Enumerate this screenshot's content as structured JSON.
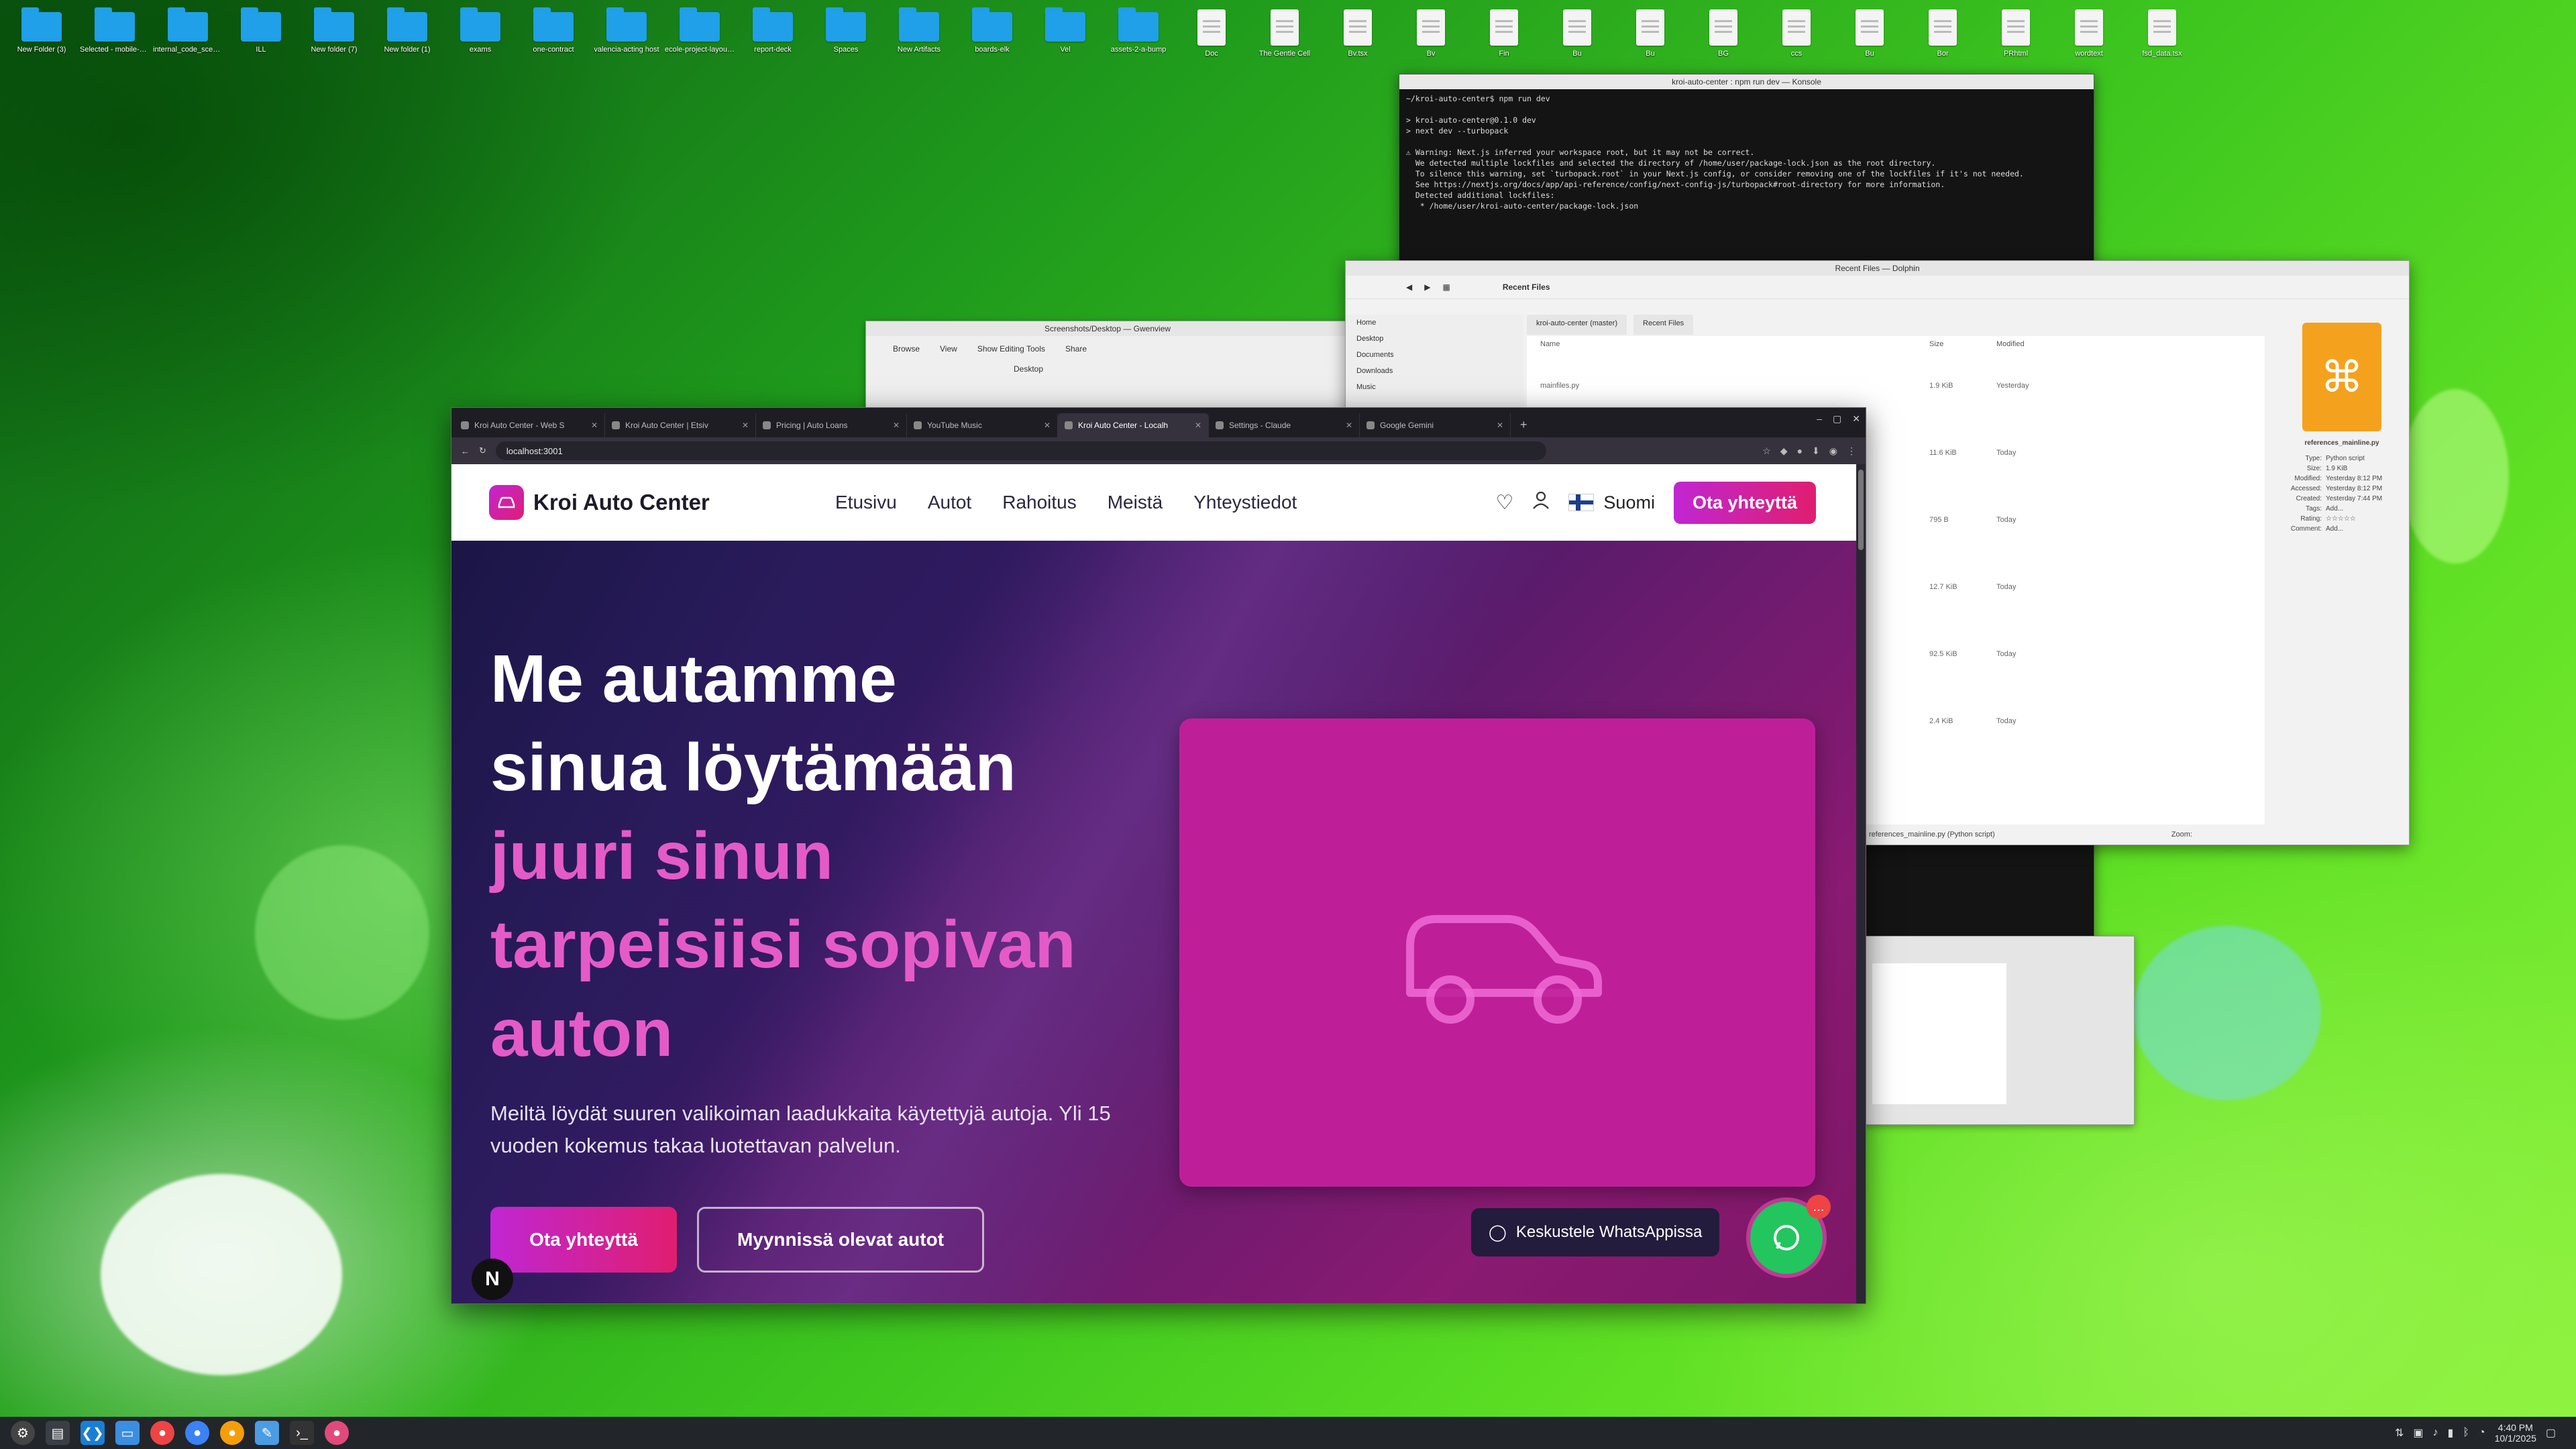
{
  "desktop": {
    "icons": [
      {
        "label": "New Folder (3)",
        "type": "folder"
      },
      {
        "label": "Selected - mobile-code",
        "type": "folder"
      },
      {
        "label": "internal_code_scenario",
        "type": "folder"
      },
      {
        "label": "ILL",
        "type": "folder"
      },
      {
        "label": "New folder (7)",
        "type": "folder"
      },
      {
        "label": "New folder (1)",
        "type": "folder"
      },
      {
        "label": "exams",
        "type": "folder"
      },
      {
        "label": "one-contract",
        "type": "folder"
      },
      {
        "label": "valencia-acting host",
        "type": "folder"
      },
      {
        "label": "ecole-project-layout-file",
        "type": "folder"
      },
      {
        "label": "report-deck",
        "type": "folder"
      },
      {
        "label": "Spaces",
        "type": "folder"
      },
      {
        "label": "New Artifacts",
        "type": "folder"
      },
      {
        "label": "boards-elk",
        "type": "folder"
      },
      {
        "label": "Vel",
        "type": "folder"
      },
      {
        "label": "assets-2-a-bump",
        "type": "folder"
      },
      {
        "label": "Doc",
        "type": "file"
      },
      {
        "label": "The Gentle Cell",
        "type": "file"
      },
      {
        "label": "Bv.tsx",
        "type": "file"
      },
      {
        "label": "Bv",
        "type": "file"
      },
      {
        "label": "Fin",
        "type": "file"
      },
      {
        "label": "Bu",
        "type": "file"
      },
      {
        "label": "Bu",
        "type": "file"
      },
      {
        "label": "BG",
        "type": "file"
      },
      {
        "label": "ccs",
        "type": "file"
      },
      {
        "label": "Bu",
        "type": "file"
      },
      {
        "label": "Bor",
        "type": "file"
      },
      {
        "label": "PRhtml",
        "type": "file"
      },
      {
        "label": "wordtext",
        "type": "file"
      },
      {
        "label": "fsd_data.tsx",
        "type": "file"
      }
    ]
  },
  "terminal": {
    "title": "kroi-auto-center : npm run dev — Konsole",
    "lines": [
      "~/kroi-auto-center$ npm run dev",
      "",
      "> kroi-auto-center@0.1.0 dev",
      "> next dev --turbopack",
      "",
      "⚠ Warning: Next.js inferred your workspace root, but it may not be correct.",
      "  We detected multiple lockfiles and selected the directory of /home/user/package-lock.json as the root directory.",
      "  To silence this warning, set `turbopack.root` in your Next.js config, or consider removing one of the lockfiles if it's not needed.",
      "  See https://nextjs.org/docs/app/api-reference/config/next-config-js/turbopack#root-directory for more information.",
      "  Detected additional lockfiles:",
      "   * /home/user/kroi-auto-center/package-lock.json"
    ]
  },
  "dolphin": {
    "title": "Recent Files — Dolphin",
    "breadcrumb": "Recent Files",
    "tabs": [
      "kroi-auto-center (master)",
      "Recent Files"
    ],
    "places": [
      "Home",
      "Desktop",
      "Documents",
      "Downloads",
      "Music"
    ],
    "columns": {
      "name": "Name",
      "size": "Size",
      "modified": "Modified"
    },
    "rows": [
      {
        "name": "mainfiles.py",
        "size": "1.9 KiB",
        "modified": "Yesterday"
      },
      {
        "name": "",
        "size": "11.6 KiB",
        "modified": "Today"
      },
      {
        "name": "",
        "size": "795 B",
        "modified": "Today"
      },
      {
        "name": "",
        "size": "12.7 KiB",
        "modified": "Today"
      },
      {
        "name": "",
        "size": "92.5 KiB",
        "modified": "Today"
      },
      {
        "name": "",
        "size": "2.4 KiB",
        "modified": "Today"
      }
    ],
    "info_file": "references_mainline.py",
    "info_rows": [
      {
        "k": "Type:",
        "v": "Python script"
      },
      {
        "k": "Size:",
        "v": "1.9 KiB"
      },
      {
        "k": "Modified:",
        "v": "Yesterday 8:12 PM"
      },
      {
        "k": "Accessed:",
        "v": "Yesterday 8:12 PM"
      },
      {
        "k": "Created:",
        "v": "Yesterday 7:44 PM"
      },
      {
        "k": "Tags:",
        "v": "Add..."
      },
      {
        "k": "Rating:",
        "v": "☆☆☆☆☆"
      },
      {
        "k": "Comment:",
        "v": "Add..."
      }
    ],
    "status": "Zoom:",
    "status_left": "references_mainline.py (Python script)"
  },
  "gwenview": {
    "title": "Screenshots/Desktop — Gwenview",
    "toolbar": [
      "Browse",
      "View",
      "Show Editing Tools",
      "Share"
    ],
    "path": "Desktop"
  },
  "browser": {
    "tabs": [
      {
        "title": "Kroi Auto Center - Web S",
        "active": false
      },
      {
        "title": "Kroi Auto Center | Etsiv",
        "active": false
      },
      {
        "title": "Pricing | Auto Loans",
        "active": false
      },
      {
        "title": "YouTube Music",
        "active": false
      },
      {
        "title": "Kroi Auto Center - Localh",
        "active": true
      },
      {
        "title": "Settings - Claude",
        "active": false
      },
      {
        "title": "Google Gemini",
        "active": false
      }
    ],
    "url": "localhost:3001"
  },
  "site": {
    "brand": "Kroi Auto Center",
    "nav": [
      "Etusivu",
      "Autot",
      "Rahoitus",
      "Meistä",
      "Yhteystiedot"
    ],
    "language": "Suomi",
    "nav_cta": "Ota yhteyttä",
    "hero": {
      "line1": "Me autamme",
      "line2": "sinua löytämään",
      "accent1": "juuri sinun",
      "accent2": "tarpeisiisi sopivan",
      "accent3": "auton",
      "lead": "Meiltä löydät suuren valikoiman laadukkaita käytettyjä autoja. Yli 15 vuoden kokemus takaa luotettavan palvelun.",
      "primary": "Ota yhteyttä",
      "secondary": "Myynnissä olevat autot"
    },
    "whatsapp_label": "Keskustele WhatsAppissa",
    "whatsapp_badge": "…",
    "n_badge": "N"
  },
  "taskbar": {
    "clock_time": "4:40 PM",
    "clock_date": "10/1/2025"
  }
}
